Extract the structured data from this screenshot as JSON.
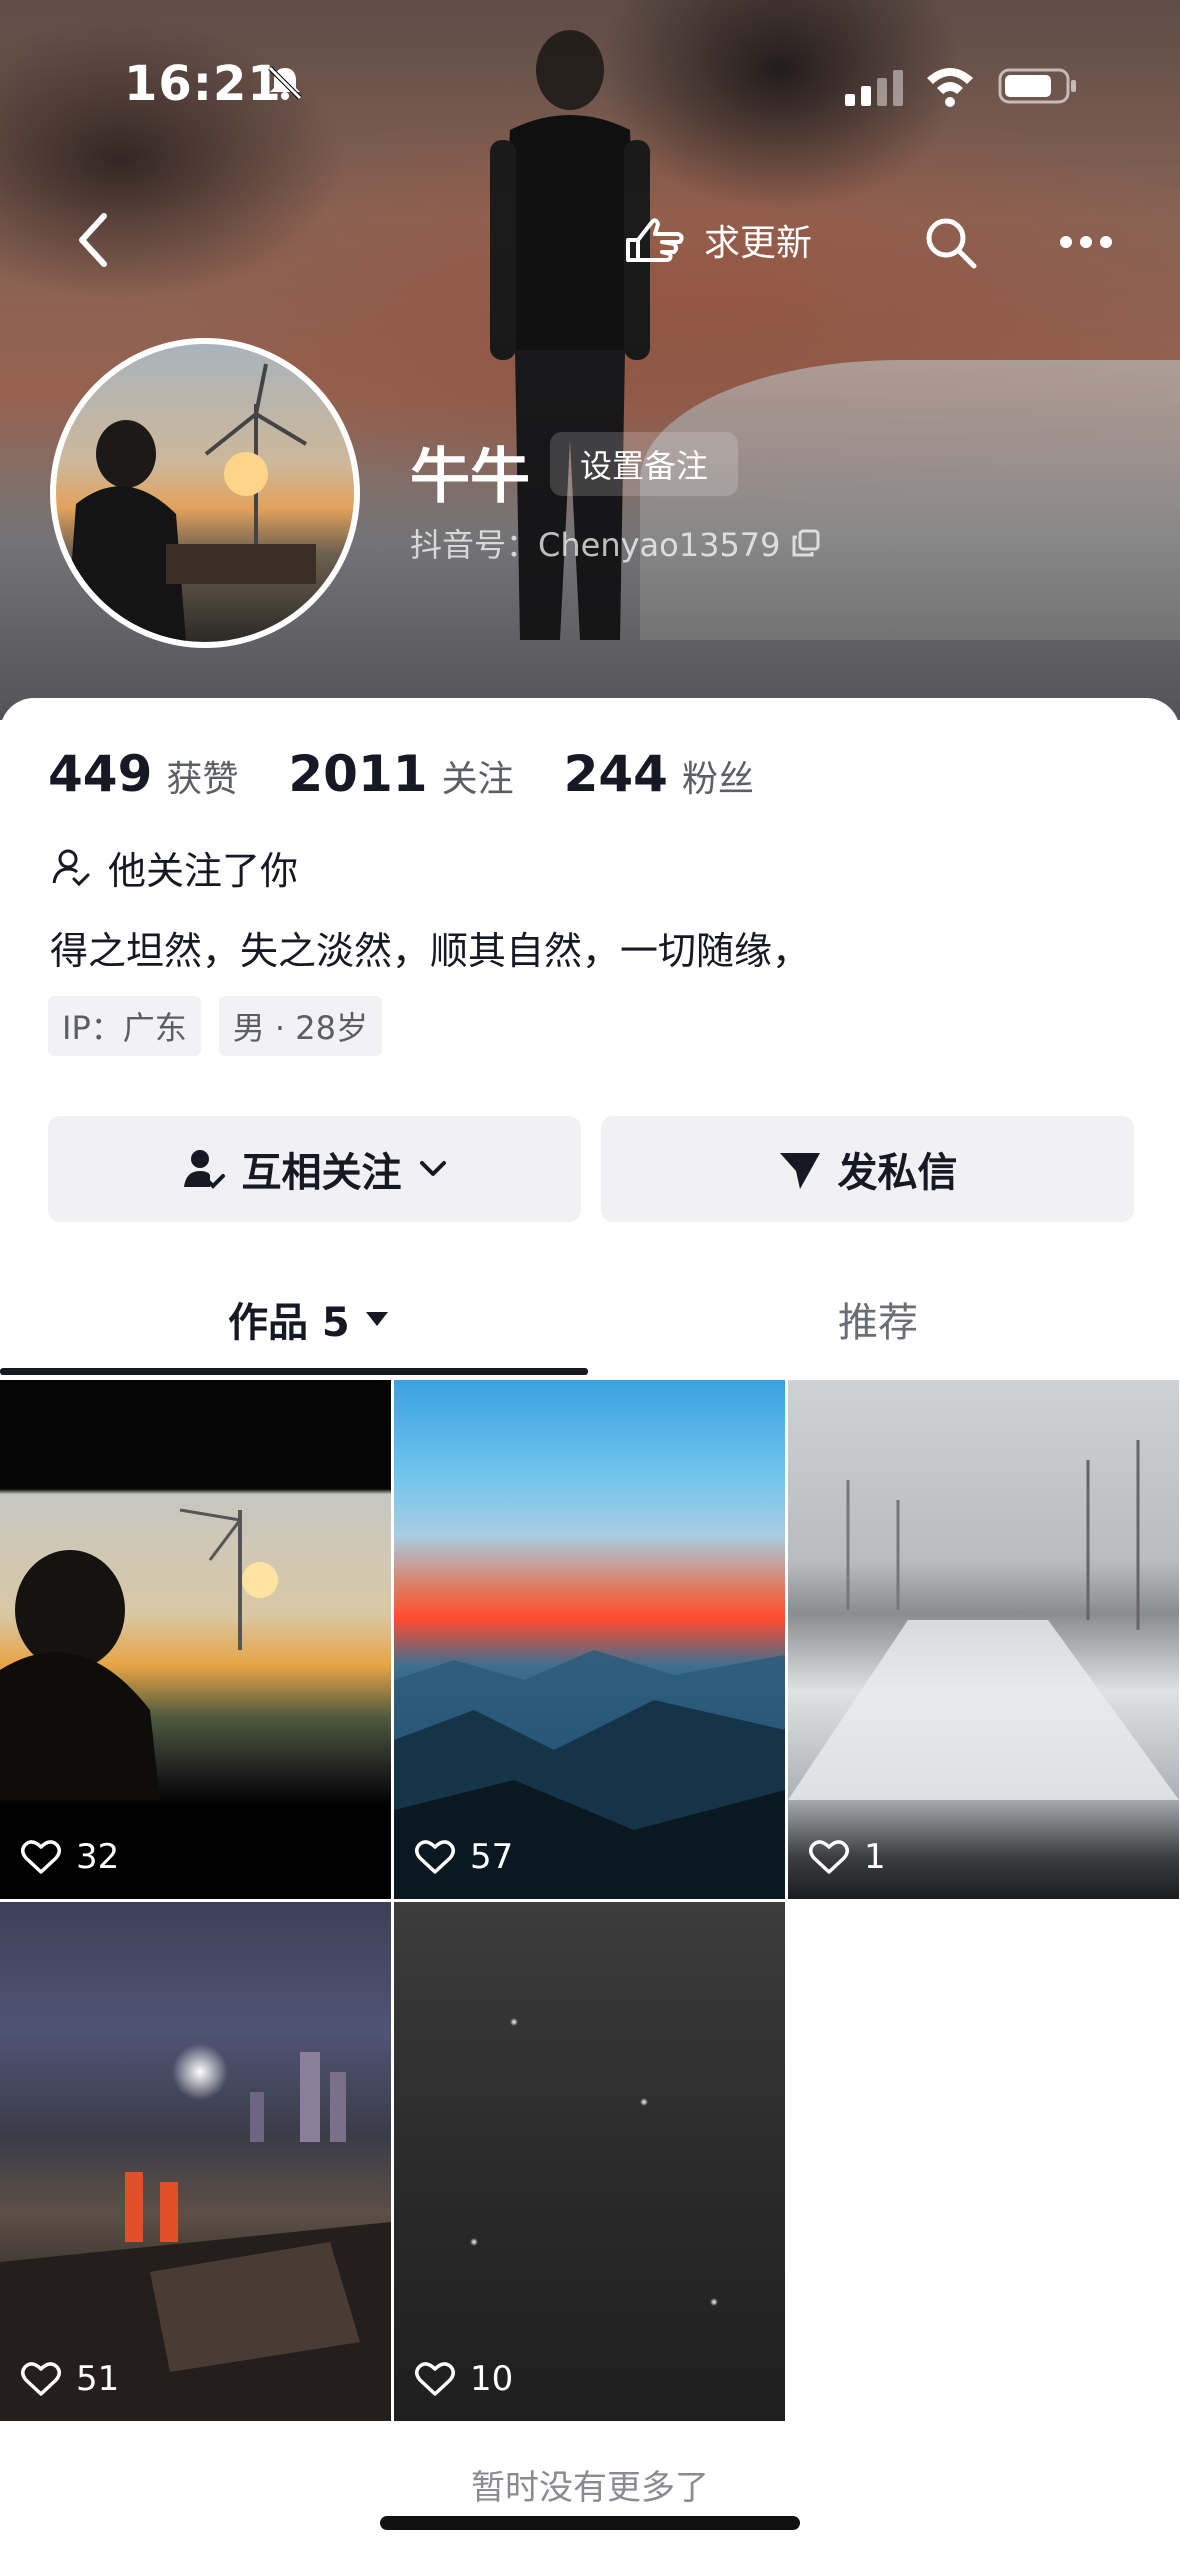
{
  "status_bar": {
    "time": "16:21",
    "icons": [
      "bell-slash-icon",
      "signal-icon",
      "wifi-icon",
      "battery-icon"
    ]
  },
  "top_nav": {
    "back_icon": "chevron-left-icon",
    "update_label": "求更新",
    "update_icon": "pointing-hand-icon",
    "search_icon": "search-icon",
    "more_icon": "more-icon"
  },
  "profile": {
    "nickname": "牛牛",
    "remark_label": "设置备注",
    "douyin_id": "抖音号：Chenyao13579",
    "copy_icon": "copy-icon"
  },
  "stats": [
    {
      "value": "449",
      "label": "获赞"
    },
    {
      "value": "2011",
      "label": "关注"
    },
    {
      "value": "244",
      "label": "粉丝"
    }
  ],
  "follow_status": "他关注了你",
  "bio": "得之坦然，失之淡然，顺其自然，一切随缘，",
  "tags": [
    "IP：广东",
    "男 · 28岁"
  ],
  "actions": {
    "mutual_follow": "互相关注",
    "message": "发私信"
  },
  "tabs": {
    "works": "作品 5",
    "recommend": "推荐"
  },
  "videos": [
    {
      "likes": "32"
    },
    {
      "likes": "57"
    },
    {
      "likes": "1"
    },
    {
      "likes": "51"
    },
    {
      "likes": "10"
    }
  ],
  "footer_text": "暂时没有更多了",
  "colors": {
    "text_primary": "#161823",
    "text_secondary": "#5c5e66",
    "button_bg": "#f1f1f3"
  }
}
